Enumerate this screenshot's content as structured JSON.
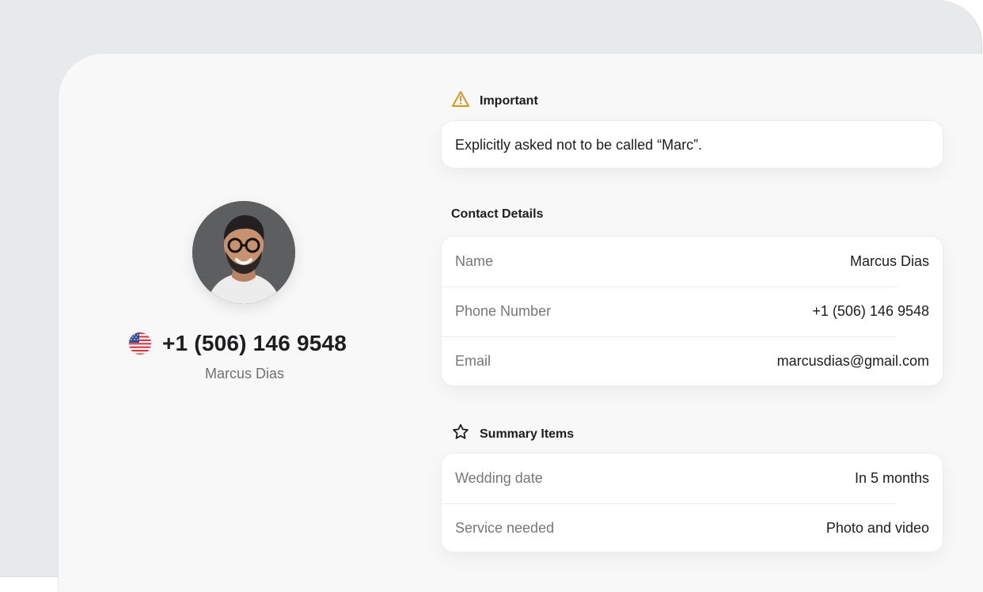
{
  "profile": {
    "phone": "+1 (506) 146 9548",
    "name": "Marcus Dias",
    "flag_icon": "us-flag-icon"
  },
  "important": {
    "title": "Important",
    "icon": "warning-triangle-icon",
    "note": "Explicitly asked not to be called “Marc”."
  },
  "contact": {
    "title": "Contact Details",
    "rows": [
      {
        "label": "Name",
        "value": "Marcus Dias"
      },
      {
        "label": "Phone Number",
        "value": "+1 (506) 146 9548"
      },
      {
        "label": "Email",
        "value": "marcusdias@gmail.com"
      }
    ]
  },
  "summary": {
    "title": "Summary Items",
    "icon": "star-outline-icon",
    "rows": [
      {
        "label": "Wedding date",
        "value": "In 5 months"
      },
      {
        "label": "Service needed",
        "value": "Photo and video"
      }
    ]
  },
  "colors": {
    "warning": "#d9941e",
    "background_outer": "#e8e9ea",
    "panel": "#f8f8f8",
    "card": "#ffffff"
  }
}
